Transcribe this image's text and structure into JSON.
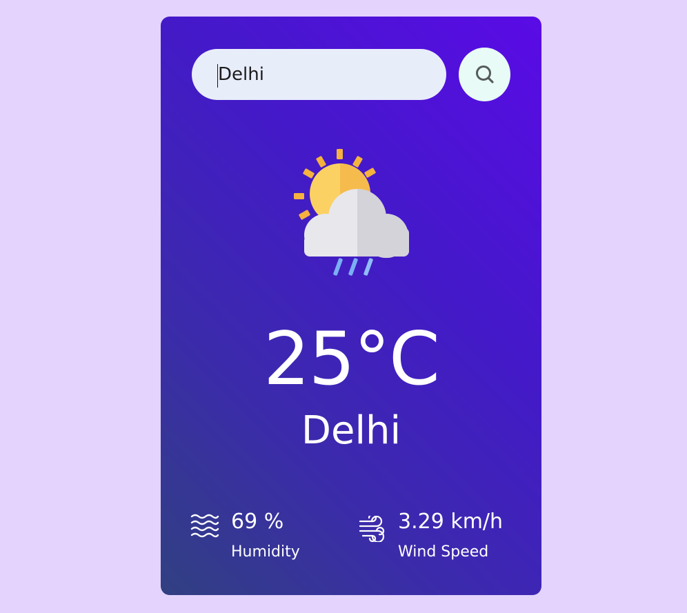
{
  "search": {
    "value": "Delhi",
    "icon": "search-icon"
  },
  "weather": {
    "icon": "sun-cloud-rain-icon",
    "temperature": "25°C",
    "city": "Delhi"
  },
  "humidity": {
    "icon": "humidity-waves-icon",
    "value": "69 %",
    "label": "Humidity"
  },
  "wind": {
    "icon": "wind-icon",
    "value": "3.29 km/h",
    "label": "Wind Speed"
  },
  "colors": {
    "page_background": "#e3d3fd",
    "card_gradient_start": "#5a0be6",
    "card_gradient_end": "#314081",
    "search_field": "#e8edfa",
    "search_button": "#e8fbf6",
    "text": "#ffffff"
  }
}
